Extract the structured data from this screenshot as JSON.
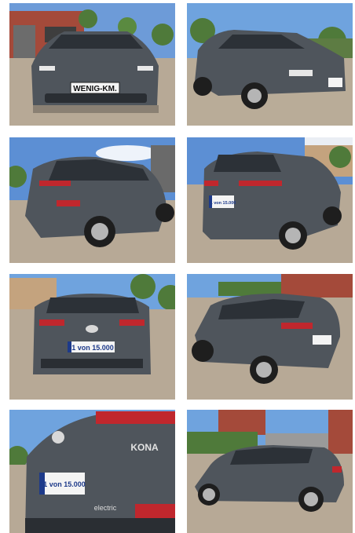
{
  "gallery": {
    "photos": [
      {
        "name": "front-view",
        "plate": "WENIG-KM."
      },
      {
        "name": "front-right-view",
        "plate": ""
      },
      {
        "name": "rear-left-view",
        "plate": ""
      },
      {
        "name": "rear-right-view",
        "plate": "1 von 15.000"
      },
      {
        "name": "rear-view",
        "plate": "1 von 15.000"
      },
      {
        "name": "side-rear-view",
        "plate": ""
      },
      {
        "name": "rear-detail-view",
        "plate": "1 von 15.000",
        "badge": "KONA",
        "badge2": "electric"
      },
      {
        "name": "side-view",
        "plate": ""
      }
    ]
  },
  "colors": {
    "car_body": "#4f555c",
    "sky": "#5c8fd4",
    "paving": "#b7a996",
    "brick": "#a44a3a",
    "foliage": "#4f7a3a",
    "taillight": "#c0272d",
    "plate_blue": "#1d3a8a"
  }
}
